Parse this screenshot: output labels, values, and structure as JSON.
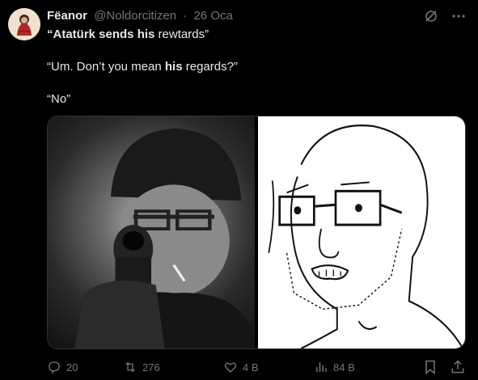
{
  "tweet": {
    "author_name": "Fëanor",
    "handle": "@Noldorcitizen",
    "separator": "·",
    "date": "26 Oca",
    "lines": [
      {
        "bold1": "“Atatürk sends ",
        "bold2": "his",
        "rest": " rewtards”"
      },
      {
        "pre": "“Um. Don’t you mean ",
        "bold": "his",
        "post": " regards?”"
      },
      {
        "text": "“No”"
      }
    ]
  },
  "media": [
    {
      "name": "man-with-pistol-photo"
    },
    {
      "name": "wojak-glasses-drawing"
    }
  ],
  "actions": {
    "replies": "20",
    "reposts": "276",
    "likes": "4 B",
    "views": "84 B"
  },
  "icons": [
    "grok-icon",
    "more-icon",
    "reply-icon",
    "repost-icon",
    "like-icon",
    "views-icon",
    "bookmark-icon",
    "share-icon"
  ],
  "colors": {
    "background": "#000000",
    "text": "#e7e9ea",
    "muted": "#71767b"
  }
}
